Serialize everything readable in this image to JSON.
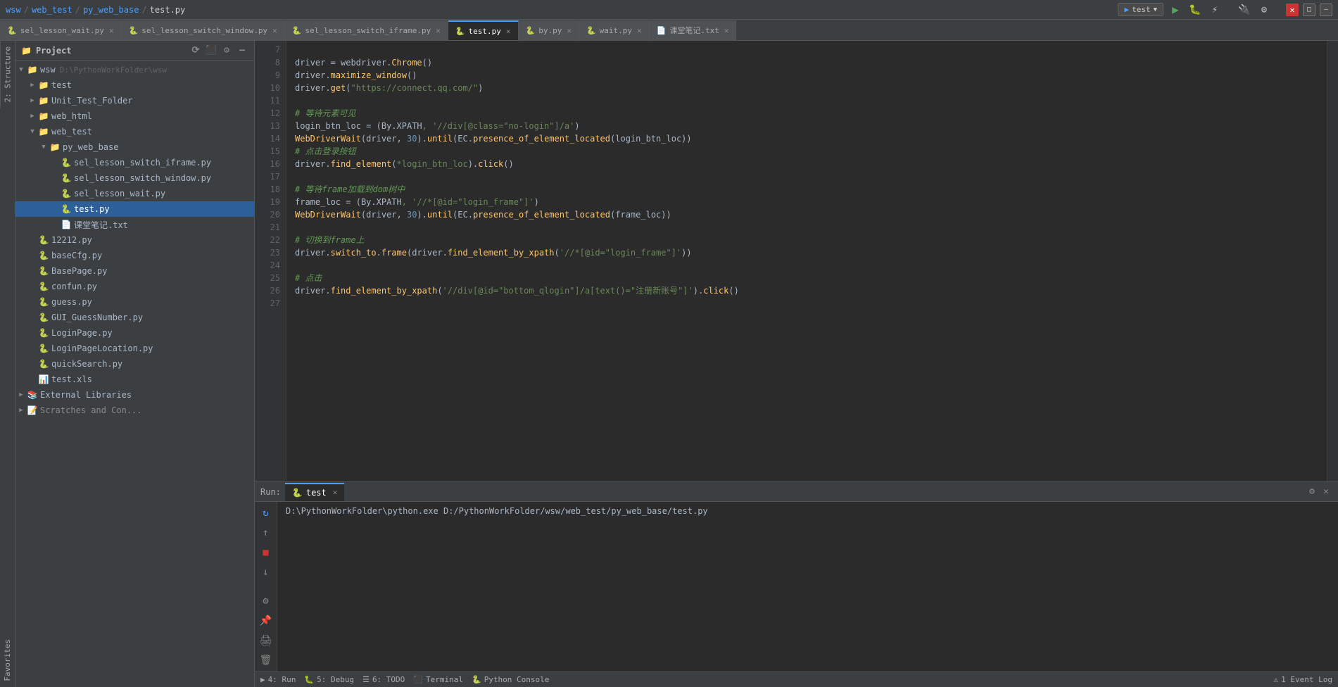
{
  "titleBar": {
    "breadcrumbs": [
      "wsw",
      "web_test",
      "py_web_base",
      "test.py"
    ],
    "runConfig": "test",
    "buttons": {
      "run": "▶",
      "debug": "🐛",
      "profile": "⚡",
      "close": "✕",
      "minimize": "—",
      "maximize": "□"
    }
  },
  "tabs": [
    {
      "id": "tab1",
      "icon": "🐍",
      "label": "sel_lesson_wait.py",
      "active": false
    },
    {
      "id": "tab2",
      "icon": "🐍",
      "label": "sel_lesson_switch_window.py",
      "active": false
    },
    {
      "id": "tab3",
      "icon": "🐍",
      "label": "sel_lesson_switch_iframe.py",
      "active": false
    },
    {
      "id": "tab4",
      "icon": "🐍",
      "label": "test.py",
      "active": true
    },
    {
      "id": "tab5",
      "icon": "🐍",
      "label": "by.py",
      "active": false
    },
    {
      "id": "tab6",
      "icon": "🐍",
      "label": "wait.py",
      "active": false
    },
    {
      "id": "tab7",
      "icon": "📄",
      "label": "课堂笔记.txt",
      "active": false
    }
  ],
  "project": {
    "header": "Project",
    "tree": [
      {
        "id": "wsw",
        "level": 0,
        "type": "folder",
        "label": "wsw",
        "extra": "D:\\PythonWorkFolder\\wsw",
        "expanded": true
      },
      {
        "id": "test",
        "level": 1,
        "type": "folder",
        "label": "test",
        "expanded": false
      },
      {
        "id": "unit_test_folder",
        "level": 1,
        "type": "folder",
        "label": "Unit_Test_Folder",
        "expanded": false
      },
      {
        "id": "web_html",
        "level": 1,
        "type": "folder",
        "label": "web_html",
        "expanded": false
      },
      {
        "id": "web_test",
        "level": 1,
        "type": "folder",
        "label": "web_test",
        "expanded": true
      },
      {
        "id": "py_web_base",
        "level": 2,
        "type": "folder",
        "label": "py_web_base",
        "expanded": true
      },
      {
        "id": "sel_lesson_switch_iframe",
        "level": 3,
        "type": "py",
        "label": "sel_lesson_switch_iframe.py"
      },
      {
        "id": "sel_lesson_switch_window",
        "level": 3,
        "type": "py",
        "label": "sel_lesson_switch_window.py"
      },
      {
        "id": "sel_lesson_wait",
        "level": 3,
        "type": "py",
        "label": "sel_lesson_wait.py"
      },
      {
        "id": "test_py",
        "level": 3,
        "type": "py",
        "label": "test.py",
        "selected": true
      },
      {
        "id": "ketang_txt",
        "level": 3,
        "type": "txt",
        "label": "课堂笔记.txt"
      },
      {
        "id": "file_12212",
        "level": 1,
        "type": "py",
        "label": "12212.py"
      },
      {
        "id": "basecfg",
        "level": 1,
        "type": "py",
        "label": "baseCfg.py"
      },
      {
        "id": "basepage",
        "level": 1,
        "type": "py",
        "label": "BasePage.py"
      },
      {
        "id": "confun",
        "level": 1,
        "type": "py",
        "label": "confun.py"
      },
      {
        "id": "guess",
        "level": 1,
        "type": "py",
        "label": "guess.py"
      },
      {
        "id": "gui_guessnumber",
        "level": 1,
        "type": "py",
        "label": "GUI_GuessNumber.py"
      },
      {
        "id": "loginpage",
        "level": 1,
        "type": "py",
        "label": "LoginPage.py"
      },
      {
        "id": "loginpagelocation",
        "level": 1,
        "type": "py",
        "label": "LoginPageLocation.py"
      },
      {
        "id": "quicksearch",
        "level": 1,
        "type": "py",
        "label": "quickSearch.py"
      },
      {
        "id": "test_xls",
        "level": 1,
        "type": "xls",
        "label": "test.xls"
      },
      {
        "id": "external_libraries",
        "level": 0,
        "type": "folder",
        "label": "External Libraries",
        "expanded": false
      },
      {
        "id": "scratches",
        "level": 0,
        "type": "folder",
        "label": "Scratches and Consoles",
        "expanded": false
      }
    ]
  },
  "editor": {
    "lines": [
      {
        "num": "7",
        "content": ""
      },
      {
        "num": "8",
        "tokens": [
          {
            "t": "obj",
            "v": "driver"
          },
          {
            "t": "obj",
            "v": " = "
          },
          {
            "t": "obj",
            "v": "webdriver"
          },
          {
            "t": "dot",
            "v": "."
          },
          {
            "t": "fn",
            "v": "Chrome"
          },
          {
            "t": "paren",
            "v": "()"
          }
        ]
      },
      {
        "num": "9",
        "tokens": [
          {
            "t": "obj",
            "v": "driver"
          },
          {
            "t": "dot",
            "v": "."
          },
          {
            "t": "fn",
            "v": "maximize_window"
          },
          {
            "t": "paren",
            "v": "()"
          }
        ]
      },
      {
        "num": "10",
        "tokens": [
          {
            "t": "obj",
            "v": "driver"
          },
          {
            "t": "dot",
            "v": "."
          },
          {
            "t": "fn",
            "v": "get"
          },
          {
            "t": "paren",
            "v": "("
          },
          {
            "t": "str",
            "v": "\"https://connect.qq.com/\""
          },
          {
            "t": "paren",
            "v": ")"
          }
        ]
      },
      {
        "num": "11",
        "content": ""
      },
      {
        "num": "12",
        "tokens": [
          {
            "t": "cmt",
            "v": "# 等待元素可见"
          }
        ]
      },
      {
        "num": "13",
        "tokens": [
          {
            "t": "obj",
            "v": "login_btn_loc"
          },
          {
            "t": "obj",
            "v": " = ("
          },
          {
            "t": "obj",
            "v": "By"
          },
          {
            "t": "dot",
            "v": "."
          },
          {
            "t": "obj",
            "v": "XPATH"
          },
          {
            "t": "str",
            "v": ", '//div[@class=\"no-login\"]/a'"
          },
          {
            "t": "obj",
            "v": ")"
          }
        ]
      },
      {
        "num": "14",
        "tokens": [
          {
            "t": "fn",
            "v": "WebDriverWait"
          },
          {
            "t": "paren",
            "v": "("
          },
          {
            "t": "obj",
            "v": "driver"
          },
          {
            "t": "obj",
            "v": ", "
          },
          {
            "t": "num",
            "v": "30"
          },
          {
            "t": "paren",
            "v": ")"
          },
          {
            "t": "dot",
            "v": "."
          },
          {
            "t": "fn",
            "v": "until"
          },
          {
            "t": "paren",
            "v": "("
          },
          {
            "t": "obj",
            "v": "EC"
          },
          {
            "t": "dot",
            "v": "."
          },
          {
            "t": "fn",
            "v": "presence_of_element_located"
          },
          {
            "t": "paren",
            "v": "("
          },
          {
            "t": "obj",
            "v": "login_btn_loc"
          },
          {
            "t": "paren",
            "v": "))"
          }
        ]
      },
      {
        "num": "15",
        "tokens": [
          {
            "t": "cmt",
            "v": "# 点击登录按钮"
          }
        ]
      },
      {
        "num": "16",
        "tokens": [
          {
            "t": "obj",
            "v": "driver"
          },
          {
            "t": "dot",
            "v": "."
          },
          {
            "t": "fn",
            "v": "find_element"
          },
          {
            "t": "paren",
            "v": "("
          },
          {
            "t": "str",
            "v": "*login_btn_loc"
          },
          {
            "t": "paren",
            "v": ")"
          },
          {
            "t": "dot",
            "v": "."
          },
          {
            "t": "fn",
            "v": "click"
          },
          {
            "t": "paren",
            "v": "()"
          }
        ]
      },
      {
        "num": "17",
        "content": ""
      },
      {
        "num": "18",
        "tokens": [
          {
            "t": "cmt",
            "v": "# 等待frame加载到dom树中"
          }
        ]
      },
      {
        "num": "19",
        "tokens": [
          {
            "t": "obj",
            "v": "frame_loc"
          },
          {
            "t": "obj",
            "v": " = ("
          },
          {
            "t": "obj",
            "v": "By"
          },
          {
            "t": "dot",
            "v": "."
          },
          {
            "t": "obj",
            "v": "XPATH"
          },
          {
            "t": "str",
            "v": ", '//*[@id=\"login_frame\"]'"
          },
          {
            "t": "obj",
            "v": ")"
          }
        ]
      },
      {
        "num": "20",
        "tokens": [
          {
            "t": "fn",
            "v": "WebDriverWait"
          },
          {
            "t": "paren",
            "v": "("
          },
          {
            "t": "obj",
            "v": "driver"
          },
          {
            "t": "obj",
            "v": ", "
          },
          {
            "t": "num",
            "v": "30"
          },
          {
            "t": "paren",
            "v": ")"
          },
          {
            "t": "dot",
            "v": "."
          },
          {
            "t": "fn",
            "v": "until"
          },
          {
            "t": "paren",
            "v": "("
          },
          {
            "t": "obj",
            "v": "EC"
          },
          {
            "t": "dot",
            "v": "."
          },
          {
            "t": "fn",
            "v": "presence_of_element_located"
          },
          {
            "t": "paren",
            "v": "("
          },
          {
            "t": "obj",
            "v": "frame_loc"
          },
          {
            "t": "paren",
            "v": "))"
          }
        ]
      },
      {
        "num": "21",
        "content": ""
      },
      {
        "num": "22",
        "tokens": [
          {
            "t": "cmt",
            "v": "# 切换到frame上"
          }
        ]
      },
      {
        "num": "23",
        "tokens": [
          {
            "t": "obj",
            "v": "driver"
          },
          {
            "t": "dot",
            "v": "."
          },
          {
            "t": "fn",
            "v": "switch_to"
          },
          {
            "t": "dot",
            "v": "."
          },
          {
            "t": "fn",
            "v": "frame"
          },
          {
            "t": "paren",
            "v": "("
          },
          {
            "t": "obj",
            "v": "driver"
          },
          {
            "t": "dot",
            "v": "."
          },
          {
            "t": "fn",
            "v": "find_element_by_xpath"
          },
          {
            "t": "paren",
            "v": "("
          },
          {
            "t": "str",
            "v": "'//*[@id=\"login_frame\"]'"
          },
          {
            "t": "paren",
            "v": "))"
          }
        ]
      },
      {
        "num": "24",
        "content": ""
      },
      {
        "num": "25",
        "tokens": [
          {
            "t": "cmt",
            "v": "# 点击"
          }
        ]
      },
      {
        "num": "26",
        "tokens": [
          {
            "t": "obj",
            "v": "driver"
          },
          {
            "t": "dot",
            "v": "."
          },
          {
            "t": "fn",
            "v": "find_element_by_xpath"
          },
          {
            "t": "paren",
            "v": "("
          },
          {
            "t": "str",
            "v": "'//div[@id=\"bottom_qlogin\"]/a[text()=\"注册新账号\"]'"
          },
          {
            "t": "paren",
            "v": ")"
          },
          {
            "t": "dot",
            "v": "."
          },
          {
            "t": "fn",
            "v": "click"
          },
          {
            "t": "paren",
            "v": "()"
          }
        ]
      },
      {
        "num": "27",
        "content": ""
      }
    ]
  },
  "runPanel": {
    "label": "Run:",
    "tab": "test",
    "command": "D:\\PythonWorkFolder\\python.exe D:/PythonWorkFolder/wsw/web_test/py_web_base/test.py"
  },
  "statusBar": {
    "items": [
      {
        "id": "build",
        "label": "▶ 4: Run"
      },
      {
        "id": "debug",
        "label": "🐛 5: Debug"
      },
      {
        "id": "todo",
        "label": "☰ 6: TODO"
      },
      {
        "id": "terminal",
        "label": "⬛ Terminal"
      },
      {
        "id": "python_console",
        "label": "🐍 Python Console"
      }
    ],
    "right": [
      {
        "id": "event_log",
        "label": "⚠ 1 Event Log"
      }
    ]
  },
  "sideLabels": {
    "structure": "2: Structure",
    "favorites": "Favorites"
  }
}
